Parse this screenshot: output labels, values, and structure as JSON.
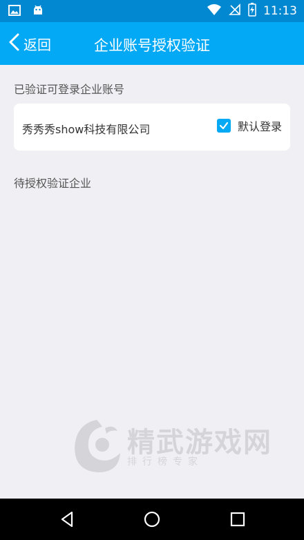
{
  "status_bar": {
    "time": "11:13"
  },
  "app_bar": {
    "back_label": "返回",
    "title": "企业账号授权验证"
  },
  "verified_section": {
    "label": "已验证可登录企业账号",
    "company": {
      "name": "秀秀秀show科技有限公司",
      "default_login_label": "默认登录",
      "default_login_checked": true
    }
  },
  "pending_section": {
    "label": "待授权验证企业"
  },
  "watermark": {
    "title": "精武游戏网",
    "subtitle": "排行榜专家"
  },
  "colors": {
    "status_bar": "#0288d1",
    "app_bar": "#03a9f4",
    "background": "#efeff4",
    "accent": "#03a9f4"
  }
}
